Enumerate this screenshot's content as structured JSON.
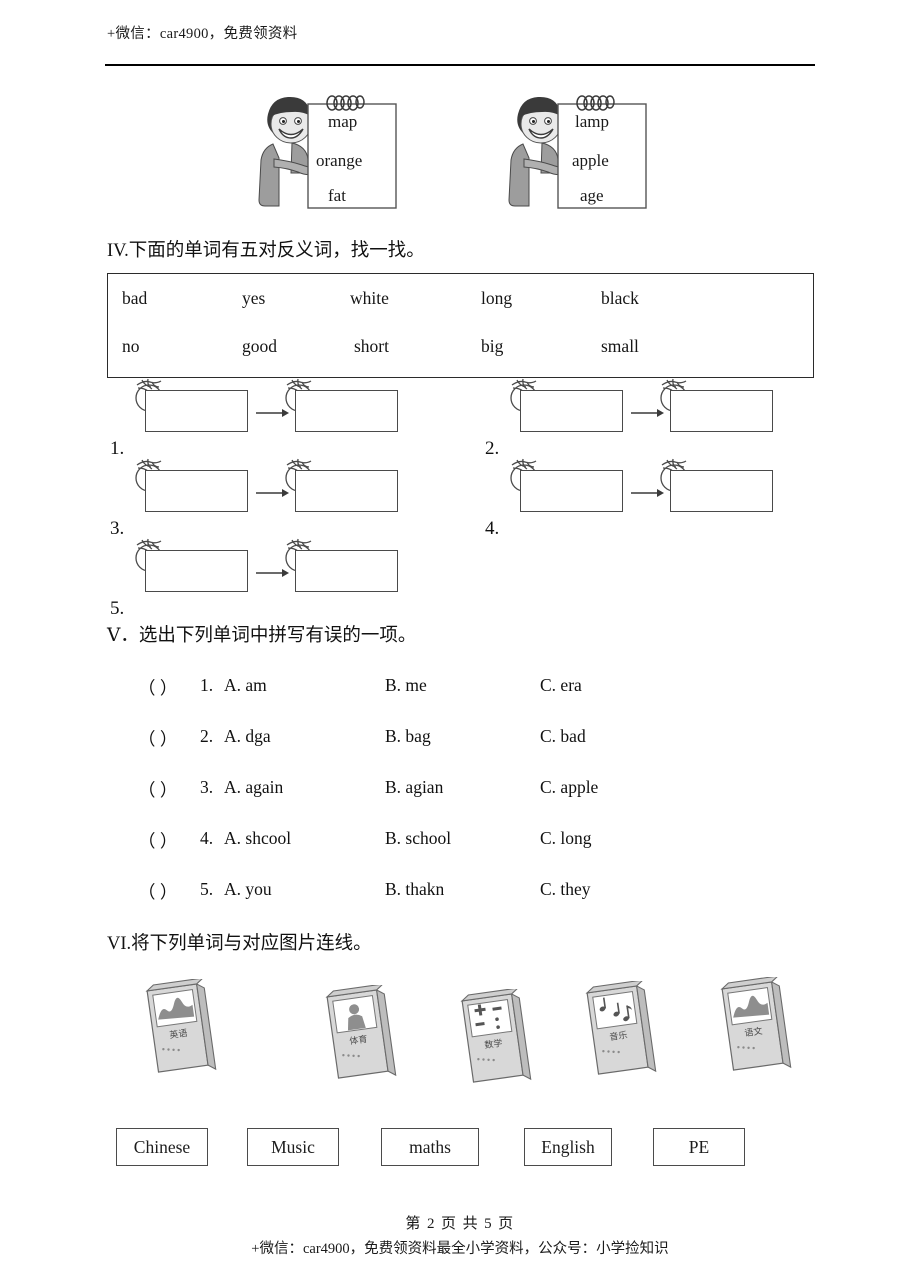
{
  "header": {
    "watermark": "+微信：car4900，免费领资料"
  },
  "illustrations": {
    "notepad_left": {
      "name": "cartoon-boy-with-notepad",
      "words": [
        "map",
        "orange",
        "fat"
      ]
    },
    "notepad_right": {
      "name": "cartoon-boy-with-notepad",
      "words": [
        "lamp",
        "apple",
        "age"
      ]
    }
  },
  "section4": {
    "heading": "IV.下面的单词有五对反义词，找一找。",
    "word_bank": {
      "row1": [
        "bad",
        "yes",
        "white",
        "long",
        "black"
      ],
      "row2": [
        "no",
        "good",
        "short",
        "big",
        "small"
      ]
    },
    "pairs": [
      {
        "index": "1.",
        "left": "",
        "right": ""
      },
      {
        "index": "2.",
        "left": "",
        "right": ""
      },
      {
        "index": "3.",
        "left": "",
        "right": ""
      },
      {
        "index": "4.",
        "left": "",
        "right": ""
      },
      {
        "index": "5.",
        "left": "",
        "right": ""
      }
    ]
  },
  "section5": {
    "heading": "Ⅴ．选出下列单词中拼写有误的一项。",
    "questions": [
      {
        "paren": "（    ）",
        "num": "1.",
        "a": "A. am",
        "b": "B. me",
        "c": "C. era"
      },
      {
        "paren": "（    ）",
        "num": "2.",
        "a": "A. dga",
        "b": "B. bag",
        "c": "C. bad"
      },
      {
        "paren": "（    ）",
        "num": "3.",
        "a": "A. again",
        "b": "B. agian",
        "c": "C. apple"
      },
      {
        "paren": "（    ）",
        "num": "4.",
        "a": "A. shcool",
        "b": "B. school",
        "c": "C. long"
      },
      {
        "paren": "（    ）",
        "num": "5.",
        "a": "A. you",
        "b": "B. thakn",
        "c": "C. they"
      }
    ]
  },
  "section6": {
    "heading": "VI.将下列单词与对应图片连线。",
    "books": [
      {
        "label": "英语",
        "cover": "map"
      },
      {
        "label": "体育",
        "cover": "person"
      },
      {
        "label": "数学",
        "cover": "symbols"
      },
      {
        "label": "音乐",
        "cover": "notes"
      },
      {
        "label": "语文",
        "cover": "map"
      }
    ],
    "word_cards": [
      "Chinese",
      "Music",
      "maths",
      "English",
      "PE"
    ]
  },
  "footer": {
    "page_label": "第 2 页 共 5 页",
    "note": "+微信：car4900，免费领资料最全小学资料，公众号：小学捡知识"
  }
}
